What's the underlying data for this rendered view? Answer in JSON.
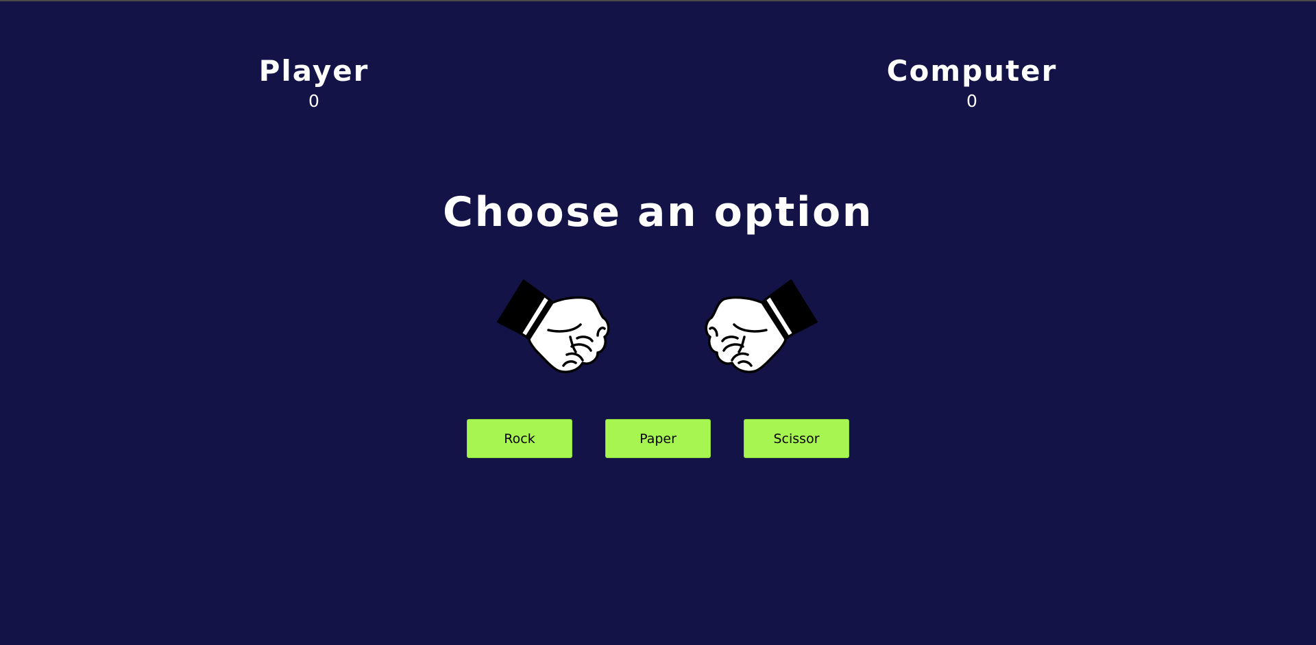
{
  "scoreboard": {
    "player": {
      "label": "Player",
      "score": "0"
    },
    "computer": {
      "label": "Computer",
      "score": "0"
    }
  },
  "heading": "Choose an option",
  "hands": {
    "left": {
      "icon": "fist-icon",
      "state": "rock"
    },
    "right": {
      "icon": "fist-icon",
      "state": "rock"
    }
  },
  "choices": [
    {
      "label": "Rock"
    },
    {
      "label": "Paper"
    },
    {
      "label": "Scissor"
    }
  ],
  "colors": {
    "background": "#131347",
    "button": "#a6f551",
    "text": "#ffffff"
  }
}
